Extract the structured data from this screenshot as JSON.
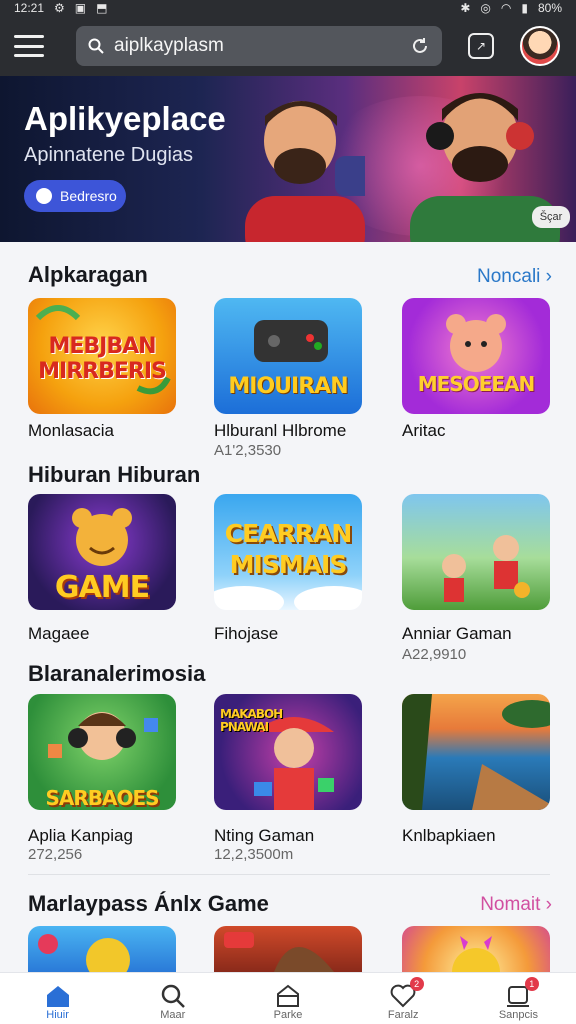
{
  "status": {
    "time": "12:21",
    "battery": "80%"
  },
  "search": {
    "value": "aiplkayplasm"
  },
  "hero": {
    "title": "Aplikyeplace",
    "subtitle": "Apinnatene Dugias",
    "button_label": "Bedresro",
    "corner_label": "Šçar"
  },
  "sections": [
    {
      "title": "Alpkaragan",
      "see_all": "Noncali ›",
      "apps": [
        {
          "name": "Monlasacia",
          "meta": "",
          "art_text": "MEBJBAN MIRRBERIS"
        },
        {
          "name": "Hlburanl Hlbrome",
          "meta": "A1'2,3530",
          "art_text": "MIOUIRAN"
        },
        {
          "name": "Aritac",
          "meta": "",
          "art_text": "MESOEEAN"
        }
      ]
    },
    {
      "title": "Hiburan Hiburan",
      "see_all": "",
      "apps": [
        {
          "name": "Magaee",
          "meta": "",
          "art_text": "GAME"
        },
        {
          "name": "Fihojase",
          "meta": "",
          "art_text": "CEARRAN MISMAIS"
        },
        {
          "name": "Anniar Gaman",
          "meta": "A22,9910",
          "art_text": ""
        }
      ]
    },
    {
      "title": "Blaranalerimosia",
      "see_all": "",
      "apps": [
        {
          "name": "Aplia Kanpiag",
          "meta": "272,256",
          "art_text": "SARBAOES"
        },
        {
          "name": "Nting Gaman",
          "meta": "12,2,3500m",
          "art_text": "MAKABOH PNAWAI"
        },
        {
          "name": "Knlbapkiaen",
          "meta": "",
          "art_text": ""
        }
      ]
    },
    {
      "title": "Marlaypass Ánlx Game",
      "see_all": "Nomait ›",
      "apps": []
    }
  ],
  "bottom_nav": [
    {
      "label": "Hiuir",
      "icon": "home-icon",
      "badge": ""
    },
    {
      "label": "Maar",
      "icon": "search-icon",
      "badge": ""
    },
    {
      "label": "Parke",
      "icon": "store-icon",
      "badge": ""
    },
    {
      "label": "Faralz",
      "icon": "heart-icon",
      "badge": "2"
    },
    {
      "label": "Sanpcis",
      "icon": "profile-icon",
      "badge": "1"
    }
  ],
  "colors": {
    "accent": "#2a78c8",
    "pink_link": "#d14fa0",
    "hero_button": "#3d55d8",
    "nav_active": "#2a6fd6"
  }
}
